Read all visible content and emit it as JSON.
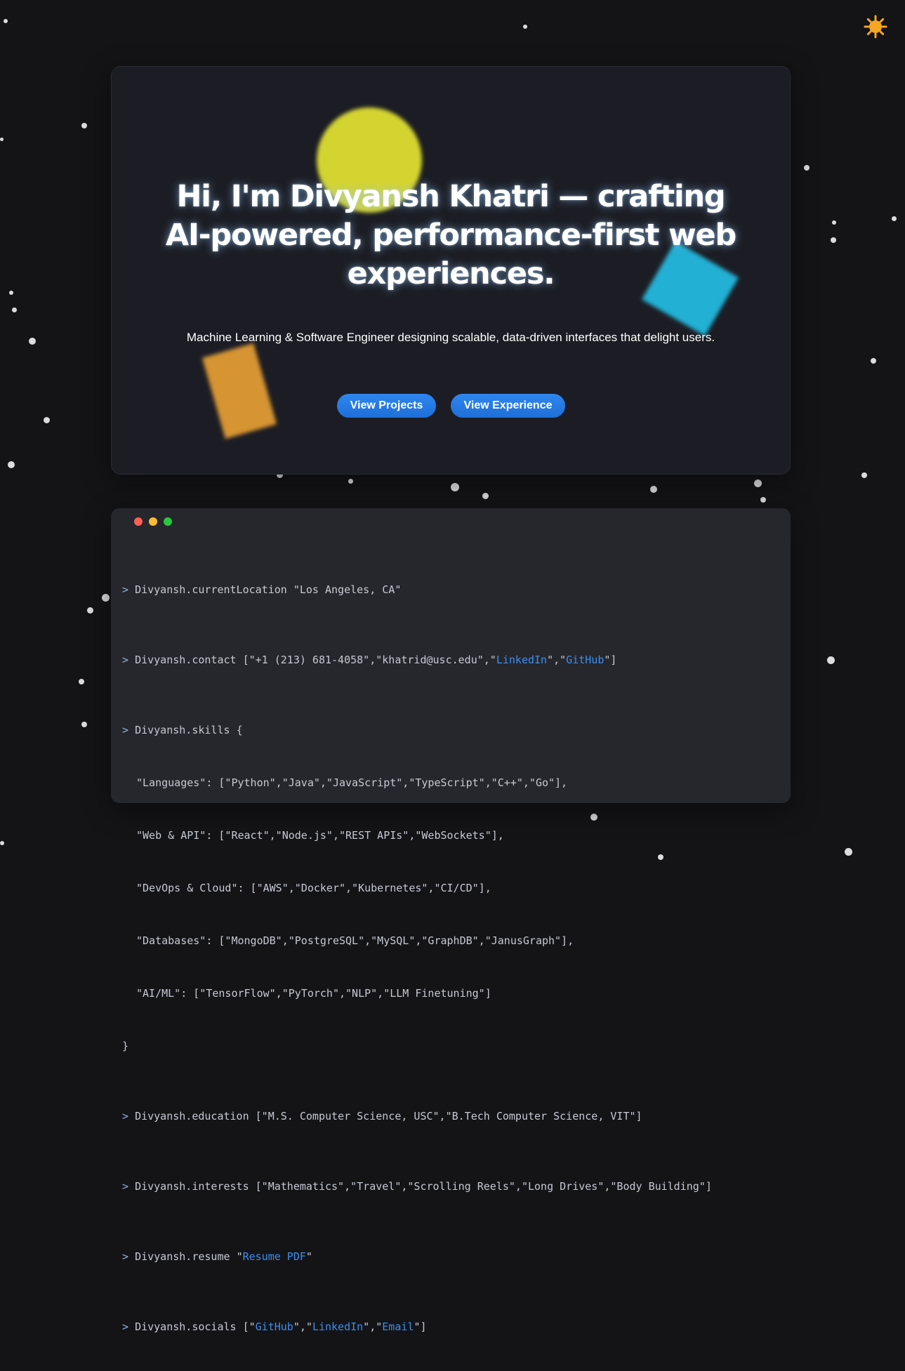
{
  "theme_toggle": {
    "icon": "sun-icon",
    "color": "#f5a623"
  },
  "hero": {
    "title": "Hi, I'm Divyansh Khatri — crafting AI-powered, performance-first web experiences.",
    "subtitle": "Machine Learning & Software Engineer designing scalable, data-driven interfaces that delight users.",
    "buttons": {
      "projects": "View Projects",
      "experience": "View Experience"
    }
  },
  "terminal": {
    "location": {
      "prompt": ">",
      "key": "Divyansh.currentLocation",
      "value": "\"Los Angeles, CA\""
    },
    "contact": {
      "prompt": ">",
      "key": "Divyansh.contact",
      "open": "[\"+1 (213) 681-4058\",\"khatrid@usc.edu\",\"",
      "link1": "LinkedIn",
      "sep": "\",\"",
      "link2": "GitHub",
      "close": "\"]"
    },
    "skills": {
      "prompt": ">",
      "key": "Divyansh.skills",
      "open": "{",
      "rows": [
        "\"Languages\": [\"Python\",\"Java\",\"JavaScript\",\"TypeScript\",\"C++\",\"Go\"],",
        "\"Web & API\": [\"React\",\"Node.js\",\"REST APIs\",\"WebSockets\"],",
        "\"DevOps & Cloud\": [\"AWS\",\"Docker\",\"Kubernetes\",\"CI/CD\"],",
        "\"Databases\": [\"MongoDB\",\"PostgreSQL\",\"MySQL\",\"GraphDB\",\"JanusGraph\"],",
        "\"AI/ML\": [\"TensorFlow\",\"PyTorch\",\"NLP\",\"LLM Finetuning\"]"
      ],
      "close": "}"
    },
    "education": {
      "prompt": ">",
      "key": "Divyansh.education",
      "value": "[\"M.S. Computer Science, USC\",\"B.Tech Computer Science, VIT\"]"
    },
    "interests": {
      "prompt": ">",
      "key": "Divyansh.interests",
      "value": "[\"Mathematics\",\"Travel\",\"Scrolling Reels\",\"Long Drives\",\"Body Building\"]"
    },
    "resume": {
      "prompt": ">",
      "key": "Divyansh.resume",
      "open": "\"",
      "link": "Resume PDF",
      "close": "\""
    },
    "socials": {
      "prompt": ">",
      "key": "Divyansh.socials",
      "open": "[\"",
      "link1": "GitHub",
      "sep1": "\",\"",
      "link2": "LinkedIn",
      "sep2": "\",\"",
      "link3": "Email",
      "close": "\"]"
    }
  },
  "colors": {
    "accent": "#2f86f0",
    "link": "#3b8ef0",
    "background": "#141417"
  }
}
